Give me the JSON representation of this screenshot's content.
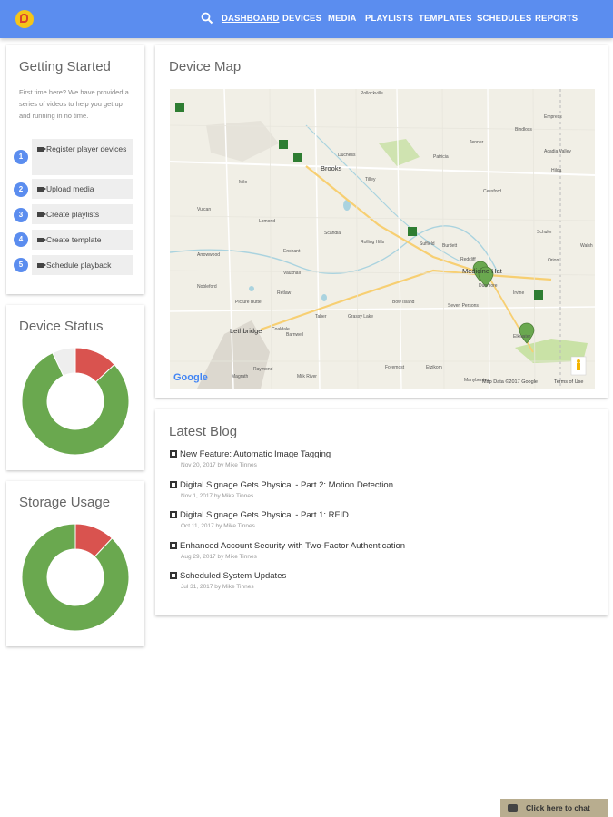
{
  "header": {
    "nav": [
      "DASHBOARD",
      "DEVICES",
      "MEDIA",
      "PLAYLISTS",
      "TEMPLATES",
      "SCHEDULES",
      "REPORTS"
    ],
    "active": "DASHBOARD",
    "colors": {
      "bar": "#5b8def"
    }
  },
  "getting_started": {
    "title": "Getting Started",
    "intro": "First time here? We have provided a series of videos to help you get up and running in no time.",
    "steps": [
      {
        "num": "1",
        "label": "Register player devices"
      },
      {
        "num": "2",
        "label": "Upload media"
      },
      {
        "num": "3",
        "label": "Create playlists"
      },
      {
        "num": "4",
        "label": "Create template"
      },
      {
        "num": "5",
        "label": "Schedule playback"
      }
    ]
  },
  "device_status": {
    "title": "Device Status",
    "chart_data": {
      "type": "pie",
      "segments": [
        {
          "value": 80,
          "color": "#6aa84f"
        },
        {
          "value": 13,
          "color": "#d9534f"
        },
        {
          "value": 7,
          "color": "#eeeeee"
        }
      ]
    }
  },
  "storage_usage": {
    "title": "Storage Usage",
    "chart_data": {
      "type": "pie",
      "segments": [
        {
          "value": 88,
          "color": "#6aa84f"
        },
        {
          "value": 12,
          "color": "#d9534f"
        }
      ]
    }
  },
  "device_map": {
    "title": "Device Map",
    "cities": [
      "Medicine Hat",
      "Lethbridge",
      "Brooks"
    ],
    "places": [
      "Pollockville",
      "Empress",
      "Bindloss",
      "Duchess",
      "Tilley",
      "Rolling Hills",
      "Suffield",
      "Scandia",
      "Vauxhall",
      "Enchant",
      "Picture Butte",
      "Taber",
      "Bow Island",
      "Etzikom",
      "Foremost",
      "Raymond",
      "Magrath",
      "Milk River",
      "Manyberries",
      "Elkwater",
      "Irvine",
      "Schuler",
      "Seven Persons",
      "Redcliff",
      "Dunmore",
      "Coaldale",
      "Burdett",
      "Barnwell",
      "Grassy Lake",
      "Retlaw",
      "Lomond",
      "Milo",
      "Vulcan",
      "Arrowwood",
      "Patricia",
      "Jenner",
      "Hilda",
      "Acadia Valley",
      "Cessford",
      "Walsh",
      "Orion",
      "Nobleford"
    ],
    "footer": {
      "data": "Map Data ©2017 Google",
      "terms": "Terms of Use",
      "google": "Google"
    }
  },
  "latest_blog": {
    "title": "Latest Blog",
    "posts": [
      {
        "title": "New Feature: Automatic Image Tagging",
        "meta": "Nov 20, 2017 by Mike Tinnes"
      },
      {
        "title": "Digital Signage Gets Physical - Part 2: Motion Detection",
        "meta": "Nov 1, 2017 by Mike Tinnes"
      },
      {
        "title": "Digital Signage Gets Physical - Part 1: RFID",
        "meta": "Oct 11, 2017 by Mike Tinnes"
      },
      {
        "title": "Enhanced Account Security with Two-Factor Authentication",
        "meta": "Aug 29, 2017 by Mike Tinnes"
      },
      {
        "title": "Scheduled System Updates",
        "meta": "Jul 31, 2017 by Mike Tinnes"
      }
    ]
  },
  "chat": {
    "label": "Click here to chat"
  }
}
